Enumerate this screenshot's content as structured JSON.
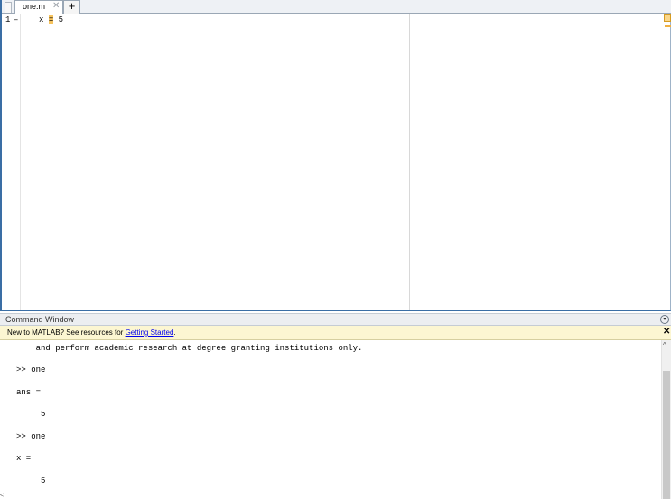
{
  "editor": {
    "tabs": [
      {
        "label": "one.m",
        "close_glyph": "✕"
      }
    ],
    "add_tab_glyph": "+",
    "line_numbers": [
      "1"
    ],
    "breakpoint_marks": [
      "–"
    ],
    "code": {
      "before": "x ",
      "op": "=",
      "after": " 5"
    }
  },
  "command_window": {
    "title": "Command Window",
    "menu_icon": "collapse-circle-icon",
    "banner": {
      "prefix": "New to MATLAB? See resources for ",
      "link": "Getting Started",
      "suffix": ".",
      "close_glyph": "✕"
    },
    "lines": [
      "    and perform academic research at degree granting institutions only.",
      ">> one",
      "ans =",
      "     5",
      ">> one",
      "x =",
      "     5"
    ],
    "scroll_up_glyph": "^",
    "hscroll_glyph": "<"
  },
  "colors": {
    "accent_border": "#3a6ea5",
    "banner_bg": "#fcf6d2",
    "highlight": "#f6c35e"
  }
}
